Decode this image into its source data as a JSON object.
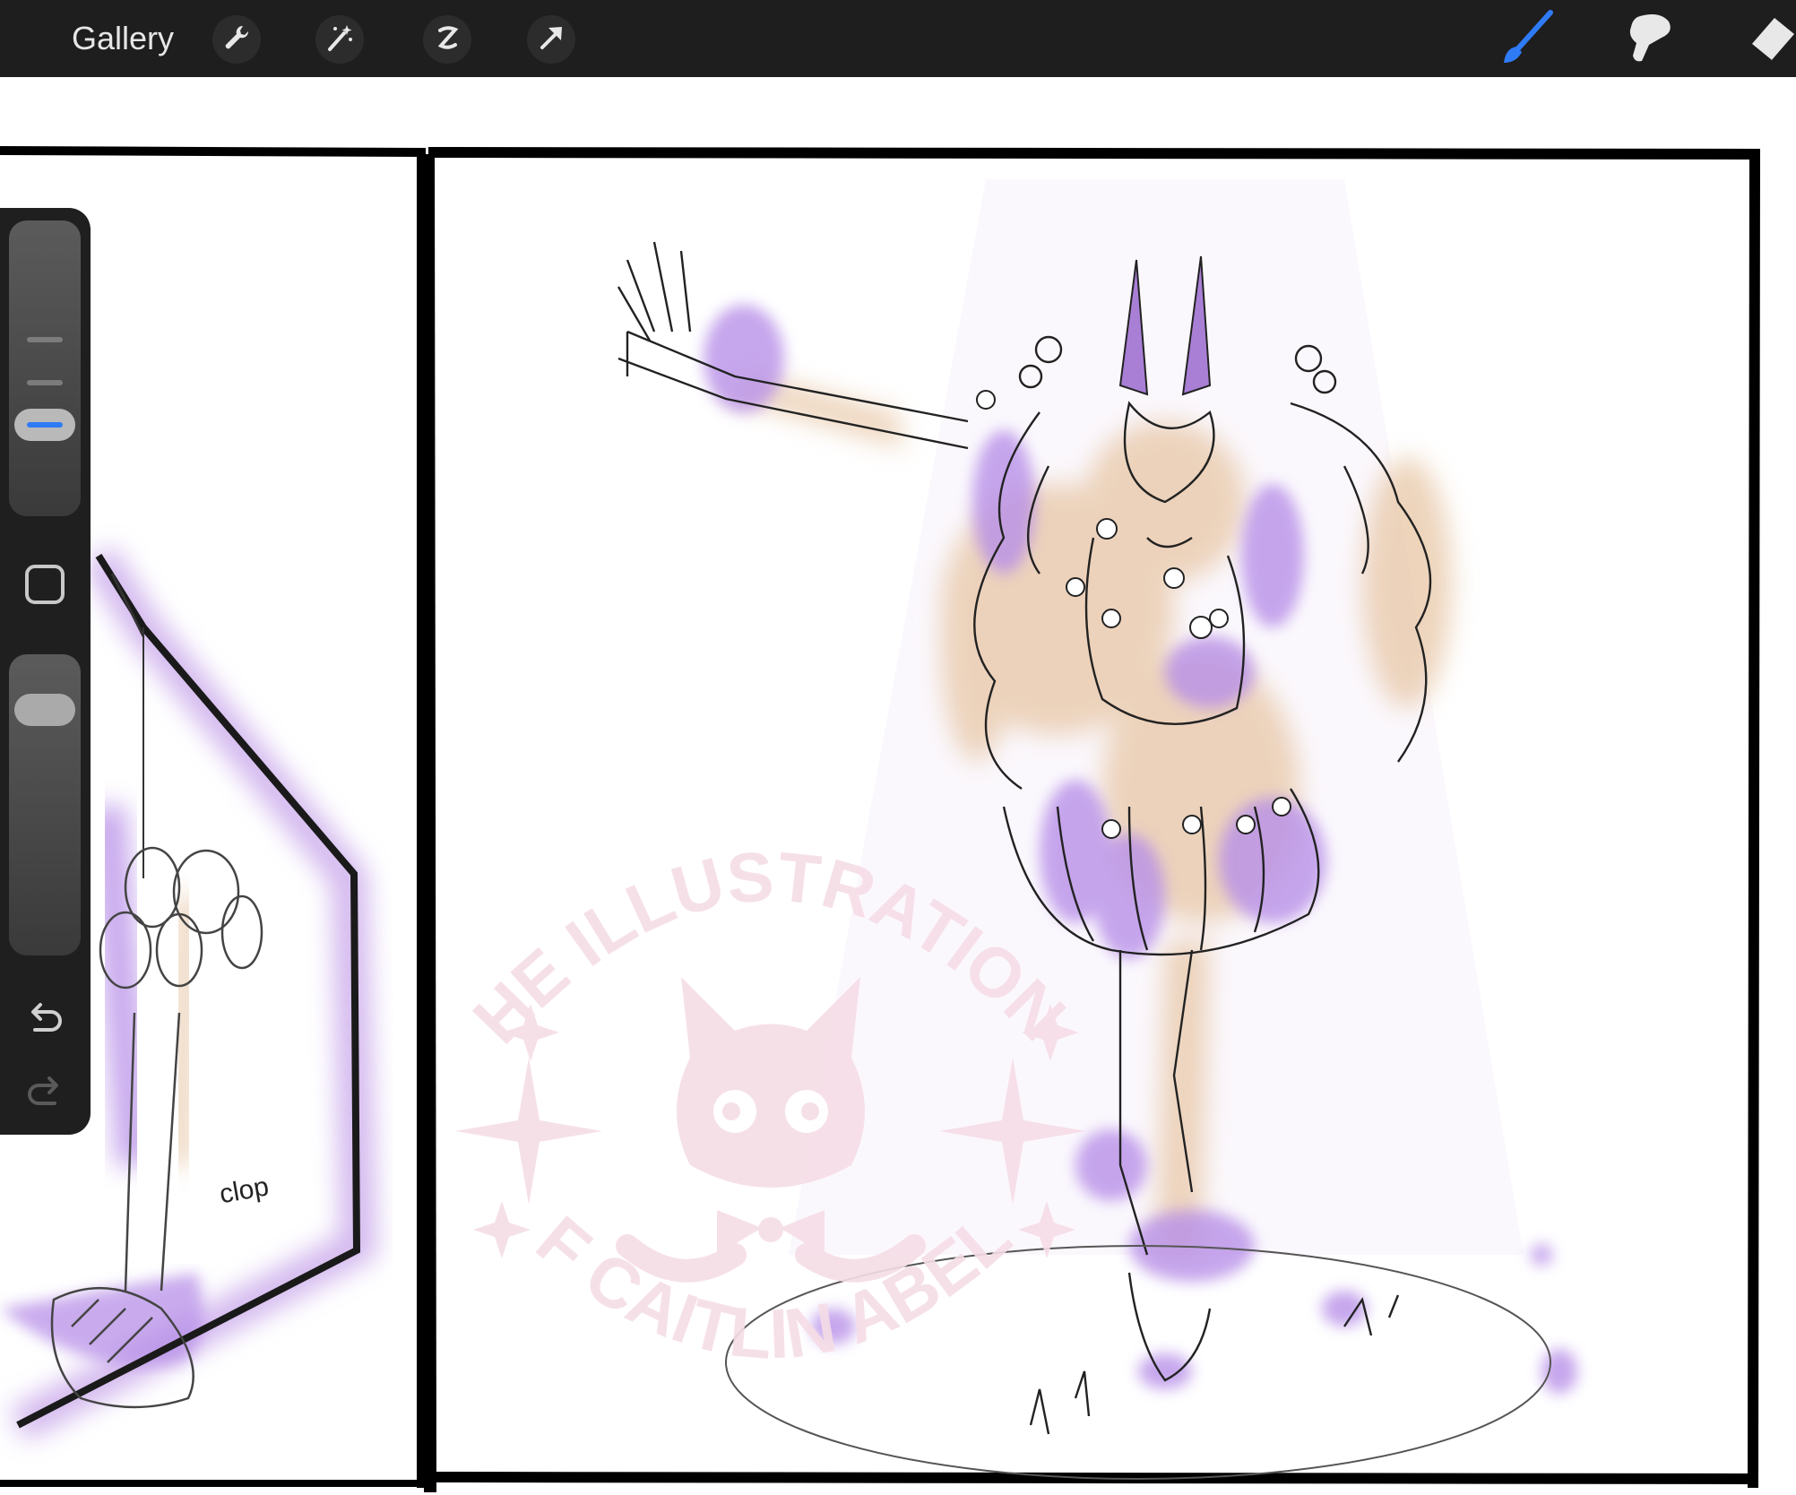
{
  "app": {
    "gallery_label": "Gallery"
  },
  "toolbar": {
    "left_tools": [
      "wrench-icon",
      "magic-wand-icon",
      "selection-icon",
      "transform-arrow-icon"
    ],
    "right_tools": [
      "brush-icon",
      "smudge-icon",
      "eraser-icon"
    ],
    "active_tool": "brush-icon"
  },
  "sidebar": {
    "brush_size_label": "",
    "opacity_label": "",
    "buttons": [
      "modify-square-icon",
      "undo-icon",
      "redo-icon"
    ]
  },
  "artwork": {
    "sound_effect": "clop",
    "watermark_top": "THE ILLUSTRATIONS",
    "watermark_bottom": "OF CAITLIN ABELE"
  },
  "colors": {
    "toolbar_bg": "#1e1e1e",
    "accent_blue": "#2f7bf6",
    "lavender": "#b890e8",
    "peach": "#e7c6a5",
    "watermark_pink": "#f6dde6"
  }
}
